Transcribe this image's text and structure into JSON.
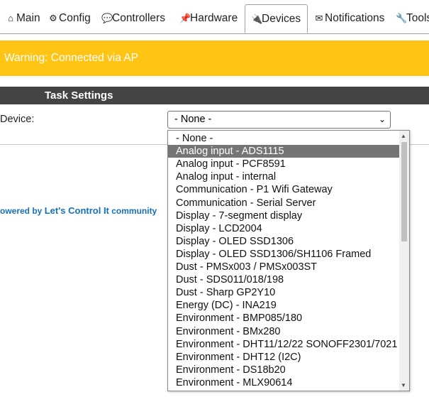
{
  "tabs": [
    {
      "label": "Main",
      "icon": "⌂",
      "icon_name": "home-icon"
    },
    {
      "label": "Config",
      "icon": "⚙",
      "icon_name": "gear-icon"
    },
    {
      "label": "Controllers",
      "icon": "💬",
      "icon_name": "chat-icon"
    },
    {
      "label": "Hardware",
      "icon": "📌",
      "icon_name": "pin-icon"
    },
    {
      "label": "Devices",
      "icon": "🔌",
      "icon_name": "plug-icon",
      "active": true
    },
    {
      "label": "Notifications",
      "icon": "✉",
      "icon_name": "envelope-icon"
    },
    {
      "label": "Tools",
      "icon": "🔧",
      "icon_name": "wrench-icon"
    }
  ],
  "warning": {
    "text": "Warning: Connected via AP",
    "color": "#ffc414"
  },
  "task_settings": {
    "title": "Task Settings",
    "device_label": "Device:"
  },
  "device_select": {
    "value": "- None -"
  },
  "footer": {
    "prefix": "owered by ",
    "brand": "Let's Control It",
    "suffix": " community"
  },
  "dropdown_options": [
    "- None -",
    "Analog input - ADS1115",
    "Analog input - PCF8591",
    "Analog input - internal",
    "Communication - P1 Wifi Gateway",
    "Communication - Serial Server",
    "Display - 7-segment display",
    "Display - LCD2004",
    "Display - OLED SSD1306",
    "Display - OLED SSD1306/SH1106 Framed",
    "Dust - PMSx003 / PMSx003ST",
    "Dust - SDS011/018/198",
    "Dust - Sharp GP2Y10",
    "Energy (DC) - INA219",
    "Environment - BMP085/180",
    "Environment - BMx280",
    "Environment - DHT11/12/22  SONOFF2301/7021",
    "Environment - DHT12 (I2C)",
    "Environment - DS18b20",
    "Environment - MLX90614"
  ],
  "highlighted_option": "Analog input - ADS1115"
}
